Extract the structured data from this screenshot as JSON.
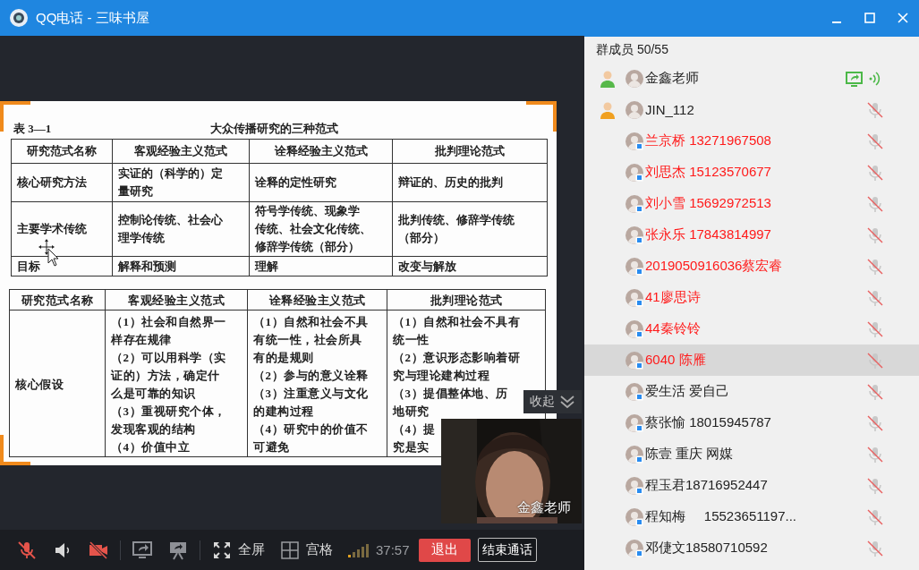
{
  "window": {
    "title": "QQ电话 - 三味书屋"
  },
  "shared_document": {
    "caption": "表 3—1",
    "title": "大众传播研究的三种范式",
    "tables": [
      {
        "header": [
          "研究范式名称",
          "客观经验主义范式",
          "诠释经验主义范式",
          "批判理论范式"
        ],
        "rows": [
          [
            [
              "核心研究方法"
            ],
            [
              "实证的（科学的）定",
              "量研究"
            ],
            [
              "诠释的定性研究"
            ],
            [
              "辩证的、历史的批判"
            ]
          ],
          [
            [
              "主要学术传统"
            ],
            [
              "控制论传统、社会心",
              "理学传统"
            ],
            [
              "符号学传统、现象学",
              "传统、社会文化传统、",
              "修辞学传统（部分）"
            ],
            [
              "批判传统、修辞学传统",
              "（部分）"
            ]
          ],
          [
            [
              "目标"
            ],
            [
              "解释和预测"
            ],
            [
              "理解"
            ],
            [
              "改变与解放"
            ]
          ]
        ]
      },
      {
        "header": [
          "研究范式名称",
          "客观经验主义范式",
          "诠释经验主义范式",
          "批判理论范式"
        ],
        "rows": [
          [
            [
              "核心假设"
            ],
            [
              "（1）社会和自然界一",
              "样存在规律",
              "（2）可以用科学（实",
              "证的）方法，确定什",
              "么是可靠的知识",
              "（3）重视研究个体，",
              "发现客观的结构",
              "（4）价值中立"
            ],
            [
              "（1）自然和社会不具",
              "有统一性，社会所具",
              "有的是规则",
              "（2）参与的意义诠释",
              "（3）注重意义与文化",
              "的建构过程",
              "（4）研究中的价值不",
              "可避免"
            ],
            [
              "（1）自然和社会不具有",
              "统一性",
              "（2）意识形态影响着研",
              "究与理论建构过程",
              "（3）提倡整体地、历",
              "地研究",
              "（4）提",
              "究是实"
            ]
          ]
        ]
      }
    ]
  },
  "collapse_button": "收起",
  "video": {
    "name": "金鑫老师"
  },
  "toolbar": {
    "buttons": [
      {
        "kind": "mic",
        "off": true
      },
      {
        "kind": "speaker",
        "off": false
      },
      {
        "kind": "camera",
        "off": true
      },
      {
        "kind": "share"
      },
      {
        "kind": "presenter"
      },
      {
        "kind": "fullscreen",
        "label": "全屏"
      },
      {
        "kind": "grid",
        "label": "宫格"
      }
    ],
    "timer": "37:57",
    "exit": "退出",
    "end_call": "结束通话"
  },
  "members": {
    "title": "群成员 50/55",
    "items": [
      {
        "name": "金鑫老师",
        "kind": "owner",
        "color": "#222222",
        "badge": false,
        "sharing": true,
        "selected": false
      },
      {
        "name": "JIN_112",
        "kind": "admin",
        "color": "#222222",
        "badge": false,
        "sharing": false,
        "muted": true,
        "selected": false
      },
      {
        "name": "兰京桥 13271967508",
        "kind": "member",
        "color": "#ff1a1a",
        "badge": true,
        "sharing": false,
        "muted": true,
        "selected": false
      },
      {
        "name": "刘思杰 15123570677",
        "kind": "member",
        "color": "#ff1a1a",
        "badge": true,
        "sharing": false,
        "muted": true,
        "selected": false
      },
      {
        "name": "刘小雪 15692972513",
        "kind": "member",
        "color": "#ff1a1a",
        "badge": true,
        "sharing": false,
        "muted": true,
        "selected": false
      },
      {
        "name": "张永乐 17843814997",
        "kind": "member",
        "color": "#ff1a1a",
        "badge": true,
        "sharing": false,
        "muted": true,
        "selected": false
      },
      {
        "name": "2019050916036蔡宏睿",
        "kind": "member",
        "color": "#ff1a1a",
        "badge": true,
        "sharing": false,
        "muted": true,
        "selected": false
      },
      {
        "name": "41廖思诗",
        "kind": "member",
        "color": "#ff1a1a",
        "badge": true,
        "sharing": false,
        "muted": true,
        "selected": false
      },
      {
        "name": "44秦铃铃",
        "kind": "member",
        "color": "#ff1a1a",
        "badge": true,
        "sharing": false,
        "muted": true,
        "selected": false
      },
      {
        "name": "6040 陈雁",
        "kind": "member",
        "color": "#ff1a1a",
        "badge": true,
        "sharing": false,
        "muted": true,
        "selected": true
      },
      {
        "name": "爱生活 爱自己",
        "kind": "member",
        "color": "#222222",
        "badge": true,
        "sharing": false,
        "muted": true,
        "selected": false
      },
      {
        "name": "蔡张愉 18015945787",
        "kind": "member",
        "color": "#222222",
        "badge": true,
        "sharing": false,
        "muted": true,
        "selected": false
      },
      {
        "name": "陈壹 重庆 网媒",
        "kind": "member",
        "color": "#222222",
        "badge": true,
        "sharing": false,
        "muted": true,
        "selected": false
      },
      {
        "name": "程玉君18716952447",
        "kind": "member",
        "color": "#222222",
        "badge": true,
        "sharing": false,
        "muted": true,
        "selected": false
      },
      {
        "name": "程知梅     15523651197...",
        "kind": "member",
        "color": "#222222",
        "badge": true,
        "sharing": false,
        "muted": true,
        "selected": false
      },
      {
        "name": "邓倢文18580710592",
        "kind": "member",
        "color": "#222222",
        "badge": true,
        "sharing": false,
        "muted": true,
        "selected": false
      }
    ]
  }
}
